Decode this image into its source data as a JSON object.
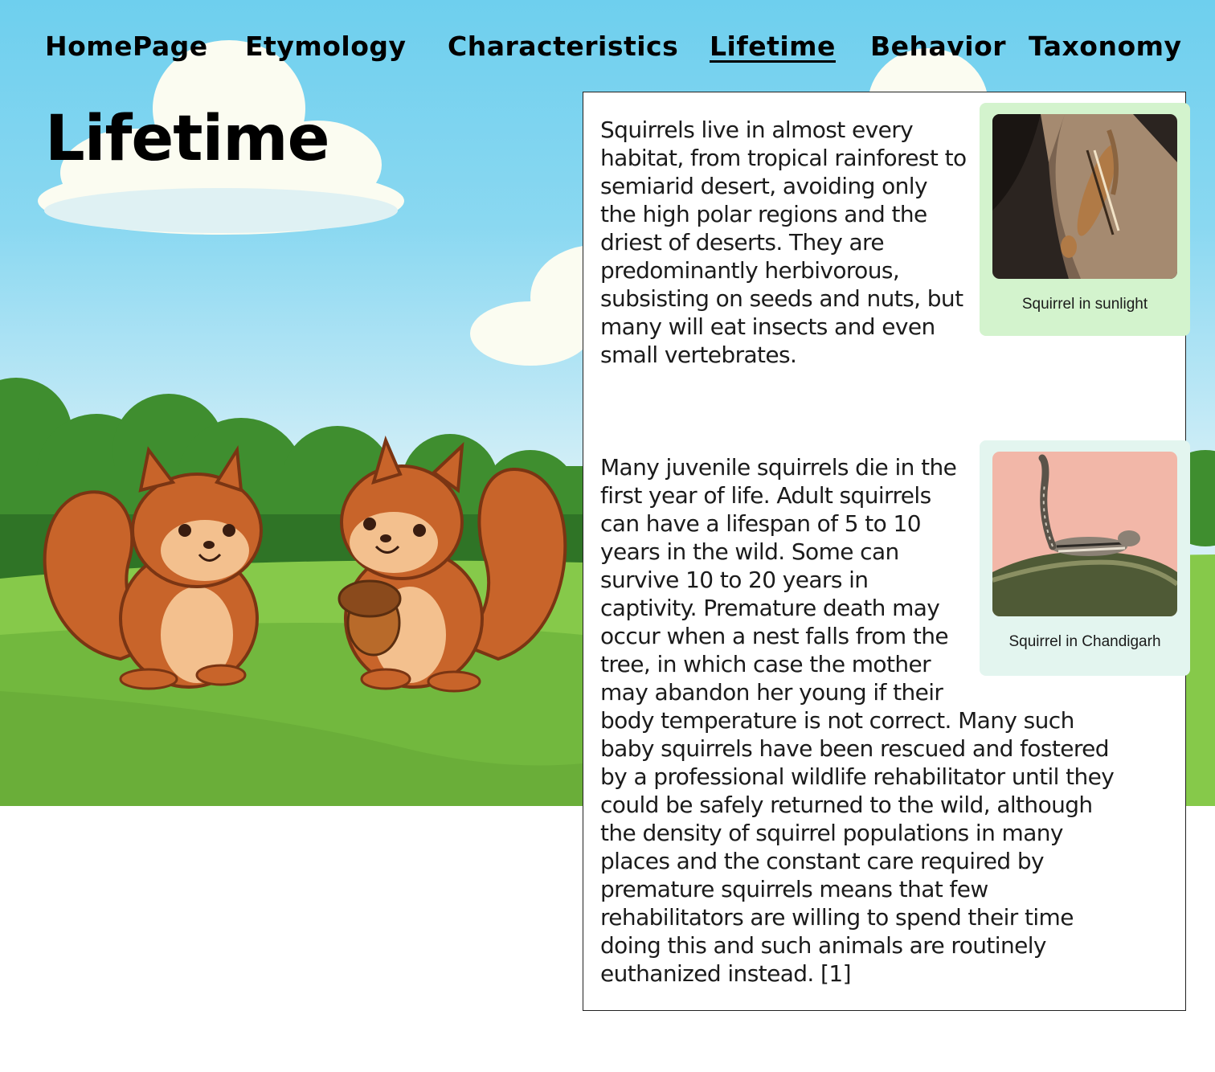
{
  "nav": {
    "items": [
      {
        "label": "HomePage",
        "active": false
      },
      {
        "label": "Etymology",
        "active": false
      },
      {
        "label": "Characteristics",
        "active": false
      },
      {
        "label": "Lifetime",
        "active": true
      },
      {
        "label": "Behavior",
        "active": false
      },
      {
        "label": "Taxonomy",
        "active": false
      }
    ]
  },
  "page": {
    "title": "Lifetime"
  },
  "content": {
    "paragraph1": "Squirrels live in almost every habitat, from tropical rainforest to semiarid desert, avoiding only the high polar regions and the driest of deserts. They are predominantly herbivorous, subsisting on seeds and nuts, but many will eat insects and even small vertebrates.",
    "figure1": {
      "caption": "Squirrel in sunlight",
      "image": "squirrel-climbing-tree-photo"
    },
    "paragraph2": "Many juvenile squirrels die in the first year of life. Adult squirrels can have a lifespan of 5 to 10 years in the wild. Some can survive 10 to 20 years in captivity. Premature death may occur when a nest falls from the tree, in which case the mother may abandon her young if their body temperature is not correct. Many such baby squirrels have been rescued and fostered by a professional wildlife rehabilitator until they could be safely returned to the wild, although the density of squirrel populations in many places and the constant care required by premature squirrels means that few rehabilitators are willing to spend their time doing this and such animals are routinely euthanized instead. [1]",
    "figure2": {
      "caption": "Squirrel in Chandigarh",
      "image": "squirrel-on-branch-photo"
    }
  },
  "colors": {
    "sky": "#6ecfee",
    "grass": "#7cc443",
    "figure1_bg": "#d3f3cd",
    "figure2_bg": "#e3f5ef",
    "squirrel_fur": "#c8642a"
  }
}
